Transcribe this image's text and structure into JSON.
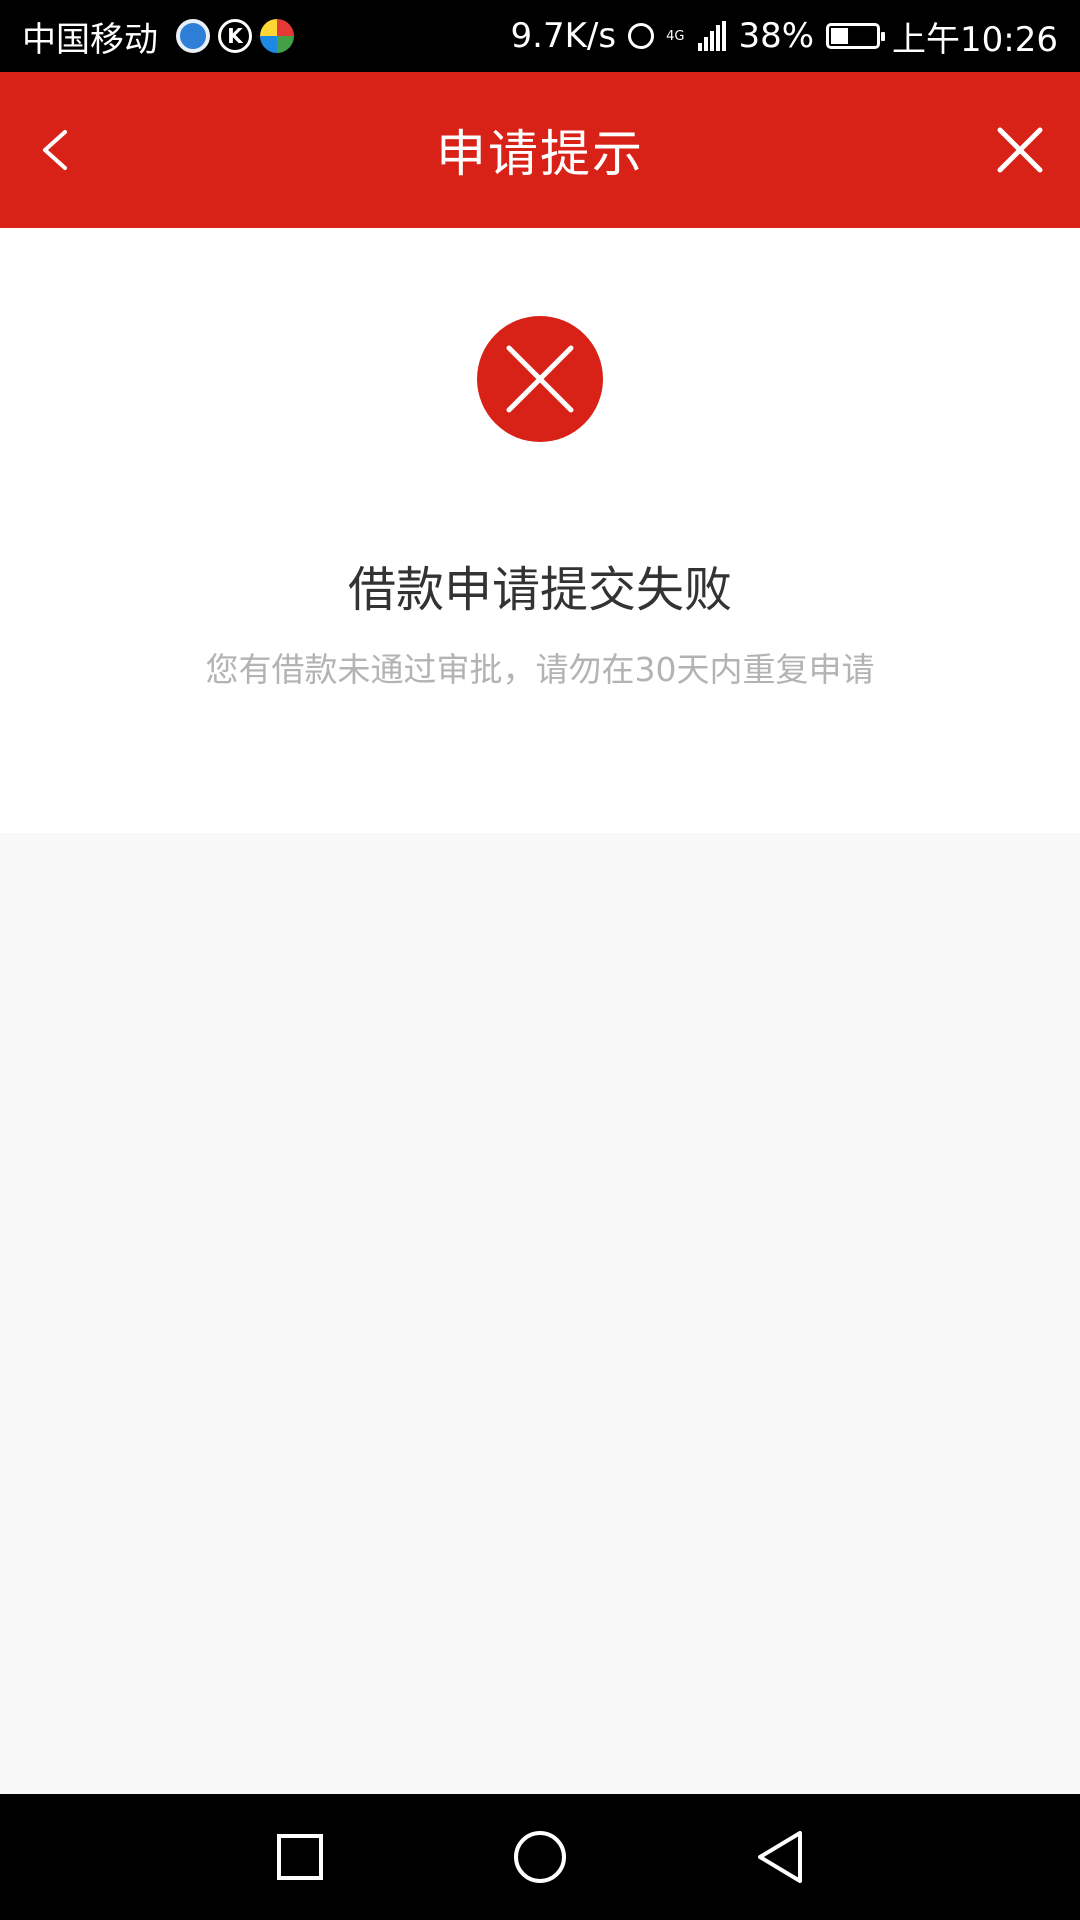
{
  "status_bar": {
    "carrier": "中国移动",
    "app_icons": [
      "q-app-icon",
      "k-app-icon",
      "color-app-icon"
    ],
    "net_speed": "9.7K/s",
    "network_type": "4G",
    "battery_percent": "38%",
    "battery_level": 0.38,
    "time": "上午10:26"
  },
  "header": {
    "title": "申请提示",
    "back_icon": "chevron-left-icon",
    "close_icon": "close-icon"
  },
  "result": {
    "icon": "error-circle-icon",
    "heading": "借款申请提交失败",
    "message": "您有借款未通过审批，请勿在30天内重复申请"
  },
  "nav_bar": {
    "icons": [
      "square-recents-icon",
      "circle-home-icon",
      "triangle-back-icon"
    ]
  },
  "colors": {
    "brand_red": "#d92217",
    "status_bar": "#000000",
    "page_background": "#f8f8f8",
    "card_background": "#ffffff",
    "heading_text": "#333333",
    "secondary_text": "#b3b3b3"
  }
}
